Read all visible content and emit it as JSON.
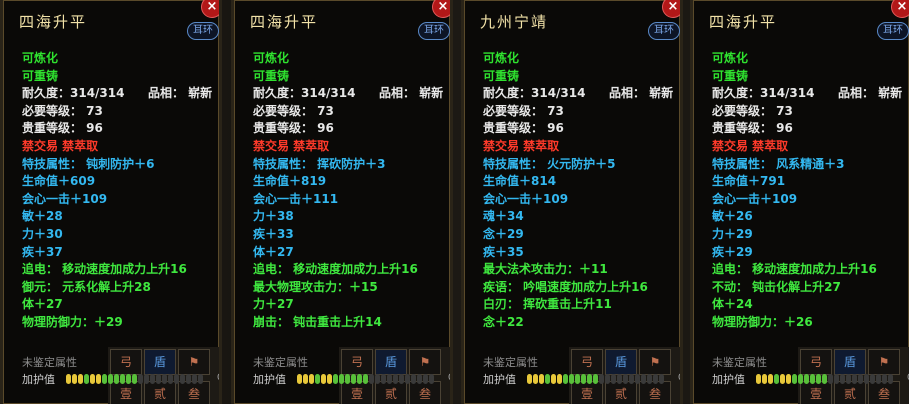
{
  "panels": [
    {
      "title": "四海升平",
      "tag": "耳环",
      "close_icon": "×",
      "lines": [
        {
          "text": "可炼化",
          "color": "green"
        },
        {
          "text": "可重铸",
          "color": "green"
        },
        {
          "text": "耐久度：314/314",
          "right": "品相： 崭新",
          "color": "white"
        },
        {
          "text": "必要等级： 73",
          "color": "white"
        },
        {
          "text": "贵重等级： 96",
          "color": "white"
        },
        {
          "text": "禁交易 禁萃取",
          "color": "red"
        },
        {
          "text": "特技属性： 钝刺防护＋6",
          "color": "cyan"
        },
        {
          "text": "生命值＋609",
          "color": "cyan"
        },
        {
          "text": "会心一击＋109",
          "color": "cyan"
        },
        {
          "text": "敏＋28",
          "color": "cyan"
        },
        {
          "text": "力＋30",
          "color": "cyan"
        },
        {
          "text": "疾＋37",
          "color": "cyan"
        },
        {
          "text": "追电： 移动速度加成力上升16",
          "color": "lime"
        },
        {
          "text": "御元： 元系化解上升28",
          "color": "lime"
        },
        {
          "text": "体＋27",
          "color": "lime"
        },
        {
          "text": "物理防御力：＋29",
          "color": "lime"
        }
      ],
      "unidentified_label": "未鉴定属性",
      "guard_label": "加护值",
      "guard_value": "0"
    },
    {
      "title": "四海升平",
      "tag": "耳环",
      "close_icon": "×",
      "lines": [
        {
          "text": "可炼化",
          "color": "green"
        },
        {
          "text": "可重铸",
          "color": "green"
        },
        {
          "text": "耐久度：314/314",
          "right": "品相： 崭新",
          "color": "white"
        },
        {
          "text": "必要等级： 73",
          "color": "white"
        },
        {
          "text": "贵重等级： 96",
          "color": "white"
        },
        {
          "text": "禁交易 禁萃取",
          "color": "red"
        },
        {
          "text": "特技属性： 挥砍防护＋3",
          "color": "cyan"
        },
        {
          "text": "生命值＋819",
          "color": "cyan"
        },
        {
          "text": "会心一击＋111",
          "color": "cyan"
        },
        {
          "text": "力＋38",
          "color": "cyan"
        },
        {
          "text": "疾＋33",
          "color": "cyan"
        },
        {
          "text": "体＋27",
          "color": "cyan"
        },
        {
          "text": "追电： 移动速度加成力上升16",
          "color": "lime"
        },
        {
          "text": "最大物理攻击力：＋15",
          "color": "lime"
        },
        {
          "text": "力＋27",
          "color": "lime"
        },
        {
          "text": "崩击： 钝击重击上升14",
          "color": "lime"
        }
      ],
      "unidentified_label": "未鉴定属性",
      "guard_label": "加护值",
      "guard_value": "0"
    },
    {
      "title": "九州宁靖",
      "tag": "耳环",
      "close_icon": "×",
      "lines": [
        {
          "text": "可炼化",
          "color": "green"
        },
        {
          "text": "可重铸",
          "color": "green"
        },
        {
          "text": "耐久度：314/314",
          "right": "品相： 崭新",
          "color": "white"
        },
        {
          "text": "必要等级： 73",
          "color": "white"
        },
        {
          "text": "贵重等级： 96",
          "color": "white"
        },
        {
          "text": "禁交易 禁萃取",
          "color": "red"
        },
        {
          "text": "特技属性： 火元防护＋5",
          "color": "cyan"
        },
        {
          "text": "生命值＋814",
          "color": "cyan"
        },
        {
          "text": "会心一击＋109",
          "color": "cyan"
        },
        {
          "text": "魂＋34",
          "color": "cyan"
        },
        {
          "text": "念＋29",
          "color": "cyan"
        },
        {
          "text": "疾＋35",
          "color": "cyan"
        },
        {
          "text": "最大法术攻击力：＋11",
          "color": "lime"
        },
        {
          "text": "疾语： 吟唱速度加成力上升16",
          "color": "lime"
        },
        {
          "text": "白刃： 挥砍重击上升11",
          "color": "lime"
        },
        {
          "text": "念＋22",
          "color": "lime"
        }
      ],
      "unidentified_label": "未鉴定属性",
      "guard_label": "加护值",
      "guard_value": "0"
    },
    {
      "title": "四海升平",
      "tag": "耳环",
      "close_icon": "×",
      "lines": [
        {
          "text": "可炼化",
          "color": "green"
        },
        {
          "text": "可重铸",
          "color": "green"
        },
        {
          "text": "耐久度：314/314",
          "right": "品相： 崭新",
          "color": "white"
        },
        {
          "text": "必要等级： 73",
          "color": "white"
        },
        {
          "text": "贵重等级： 96",
          "color": "white"
        },
        {
          "text": "禁交易 禁萃取",
          "color": "red"
        },
        {
          "text": "特技属性： 风系精通＋3",
          "color": "cyan"
        },
        {
          "text": "生命值＋791",
          "color": "cyan"
        },
        {
          "text": "会心一击＋109",
          "color": "cyan"
        },
        {
          "text": "敏＋26",
          "color": "cyan"
        },
        {
          "text": "力＋29",
          "color": "cyan"
        },
        {
          "text": "疾＋29",
          "color": "cyan"
        },
        {
          "text": "追电： 移动速度加成力上升16",
          "color": "lime"
        },
        {
          "text": "不动： 钝击化解上升27",
          "color": "lime"
        },
        {
          "text": "体＋24",
          "color": "lime"
        },
        {
          "text": "物理防御力：＋26",
          "color": "lime"
        }
      ],
      "unidentified_label": "未鉴定属性",
      "guard_label": "加护值",
      "guard_value": "0"
    }
  ],
  "guard_bar_pattern": [
    "y",
    "y",
    "y",
    "g",
    "y",
    "y",
    "g",
    "g",
    "g",
    "g",
    "g",
    "g",
    "d",
    "d",
    "d",
    "d",
    "d",
    "d",
    "d",
    "d",
    "d",
    "d",
    "d"
  ],
  "slot_glyphs": [
    "弓",
    "盾",
    "⚑",
    "壹",
    "贰",
    "叁"
  ],
  "colors": {
    "green": "#2fe22f",
    "white": "#e8e8e8",
    "red": "#ff3a2a",
    "cyan": "#33b8f0",
    "lime": "#3fe83f",
    "title": "#f2e2a8"
  }
}
